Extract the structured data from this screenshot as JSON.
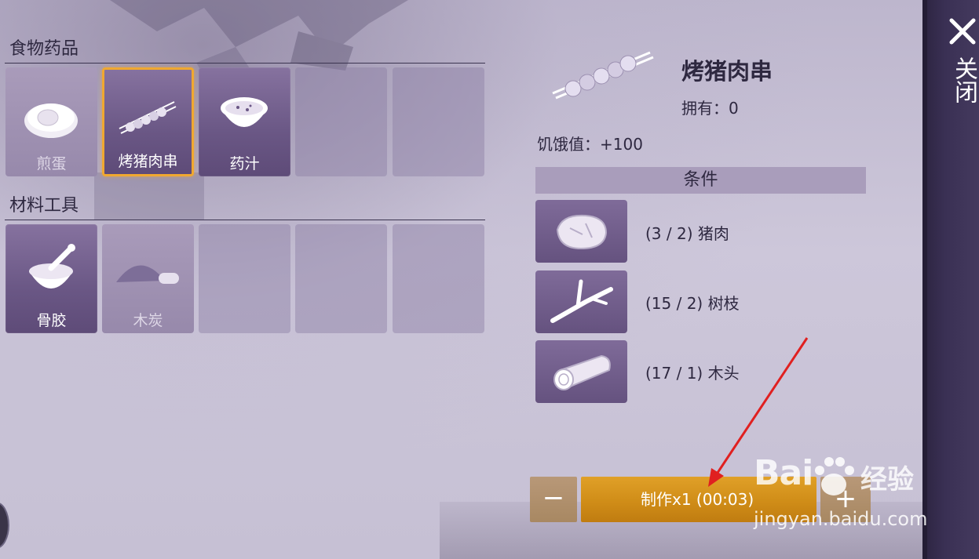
{
  "categories": [
    {
      "title": "食物药品",
      "slots": [
        {
          "label": "煎蛋",
          "icon": "fried-egg-icon",
          "state": "dim"
        },
        {
          "label": "烤猪肉串",
          "icon": "pork-skewer-icon",
          "state": "selected"
        },
        {
          "label": "药汁",
          "icon": "medicine-bowl-icon",
          "state": "filled"
        },
        {
          "label": "",
          "icon": "",
          "state": "empty"
        },
        {
          "label": "",
          "icon": "",
          "state": "empty"
        }
      ]
    },
    {
      "title": "材料工具",
      "slots": [
        {
          "label": "骨胶",
          "icon": "bone-glue-mortar-icon",
          "state": "filled"
        },
        {
          "label": "木炭",
          "icon": "charcoal-icon",
          "state": "dim"
        },
        {
          "label": "",
          "icon": "",
          "state": "empty"
        },
        {
          "label": "",
          "icon": "",
          "state": "empty"
        },
        {
          "label": "",
          "icon": "",
          "state": "empty"
        }
      ]
    }
  ],
  "detail": {
    "name": "烤猪肉串",
    "owned": "拥有：0",
    "hunger": "饥饿值：+100",
    "conditions_title": "条件",
    "requirements": [
      {
        "text": "(3 / 2) 猪肉",
        "icon": "pork-meat-icon"
      },
      {
        "text": "(15 / 2) 树枝",
        "icon": "branch-icon"
      },
      {
        "text": "(17 / 1) 木头",
        "icon": "log-icon"
      }
    ]
  },
  "controls": {
    "minus": "−",
    "make": "制作x1 (00:03)",
    "plus": "+"
  },
  "sidebar": {
    "close_label": "关闭"
  },
  "watermark": {
    "logo": "Bai",
    "brand": "经验",
    "url": "jingyan.baidu.com"
  },
  "colors": {
    "selected_border": "#f0a830",
    "make_button": "#d08d18",
    "slot_filled": "#6a5785",
    "sidebar": "#3a3054",
    "annotation_arrow": "#e02020"
  }
}
